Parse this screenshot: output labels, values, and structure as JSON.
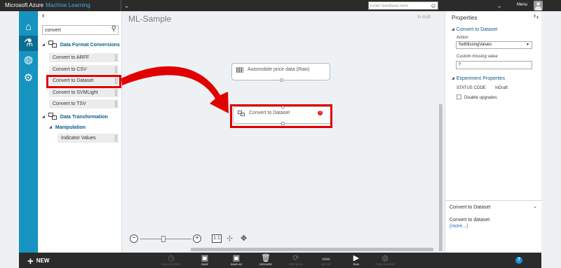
{
  "app": {
    "brand_part1": "Microsoft Azure",
    "brand_part2": "Machine Learning",
    "feedback_placeholder": "Enter feedback here",
    "menu_label": "Menu"
  },
  "palette": {
    "search_value": "convert",
    "categories": [
      {
        "label": "Data Format Conversions",
        "items": [
          "Convert to ARFF",
          "Convert to CSV",
          "Convert to Dataset",
          "Convert to SVMLight",
          "Convert to TSV"
        ]
      },
      {
        "label": "Data Transformation",
        "subcategories": [
          {
            "label": "Manipulation",
            "items": [
              "Indicator Values"
            ]
          }
        ]
      }
    ],
    "highlighted_item": "Convert to Dataset"
  },
  "canvas": {
    "experiment_title": "ML-Sample",
    "status": "In draft",
    "nodes": [
      {
        "label": "Automobile price data (Raw)",
        "icon": "dataset-icon"
      },
      {
        "label": "Convert to Dataset",
        "icon": "module-icon",
        "warning": "!"
      }
    ],
    "zoom": {
      "minus": "−",
      "plus": "+",
      "actual_size": "1:1",
      "level": 0.45
    }
  },
  "properties": {
    "title": "Properties",
    "module_section": "Convert to Dataset",
    "action_label": "Action",
    "action_value": "SetMissingValues",
    "custom_missing_label": "Custom missing value",
    "custom_missing_value": "?",
    "experiment_section": "Experiment Properties",
    "status_code_label": "STATUS CODE",
    "status_code_value": "InDraft",
    "disable_upgrades_label": "Disable upgrades",
    "quick_help_title": "Convert to Dataset",
    "quick_help_desc": "Convert to dataset",
    "more_link": "(more...)"
  },
  "commands": {
    "new": "NEW",
    "items": [
      {
        "label": "RUN HISTORY",
        "icon": "clock-icon",
        "enabled": false
      },
      {
        "label": "SAVE",
        "icon": "save-icon",
        "enabled": true
      },
      {
        "label": "SAVE AS",
        "icon": "save-as-icon",
        "enabled": true
      },
      {
        "label": "DISCARD",
        "icon": "trash-icon",
        "enabled": true
      },
      {
        "label": "REFRESH",
        "icon": "refresh-icon",
        "enabled": false
      },
      {
        "label": "SETUP",
        "icon": "setup-icon",
        "enabled": false
      },
      {
        "label": "RUN",
        "icon": "play-icon",
        "enabled": true
      },
      {
        "label": "PUBLISH WEB",
        "icon": "globe-icon",
        "enabled": false
      }
    ],
    "help": "?"
  },
  "colors": {
    "accent": "#1793bf",
    "topbar": "#2b2b2b",
    "callout_red": "#e00000",
    "warning_red": "#d62828",
    "link_blue": "#1a73c6"
  }
}
